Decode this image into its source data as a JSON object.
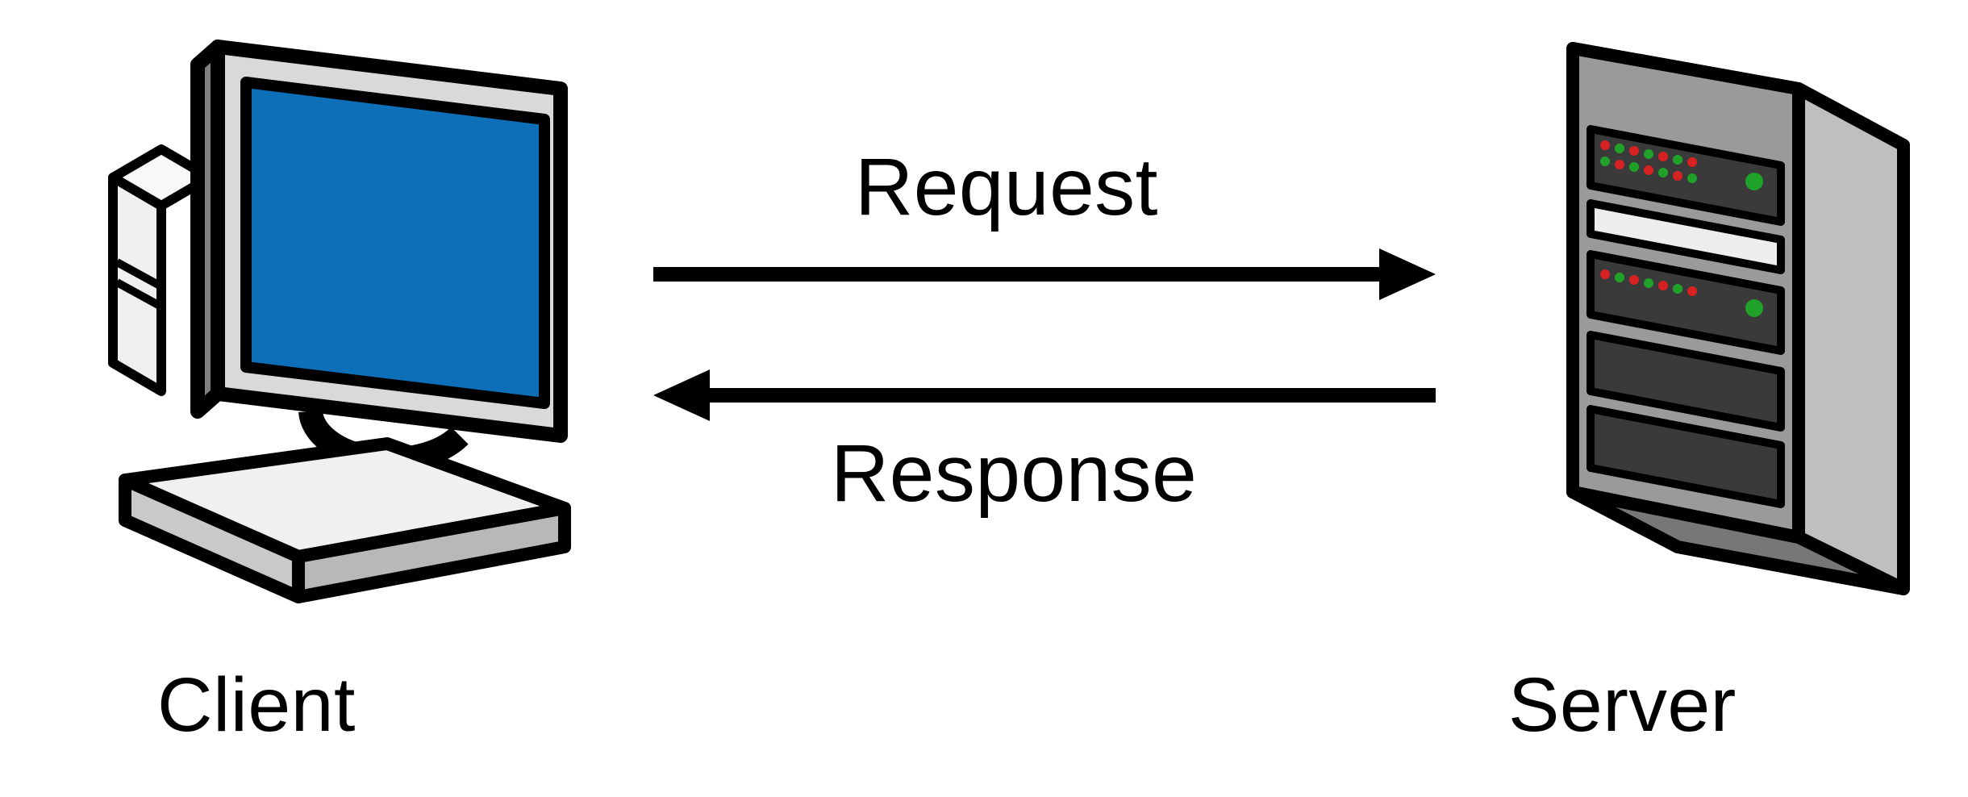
{
  "diagram": {
    "nodes": {
      "client": {
        "label": "Client",
        "icon": "computer-with-monitor-and-keyboard"
      },
      "server": {
        "label": "Server",
        "icon": "rack-server-tower"
      }
    },
    "arrows": {
      "request": {
        "label": "Request",
        "from": "client",
        "to": "server",
        "direction": "right"
      },
      "response": {
        "label": "Response",
        "from": "server",
        "to": "client",
        "direction": "left"
      }
    }
  }
}
